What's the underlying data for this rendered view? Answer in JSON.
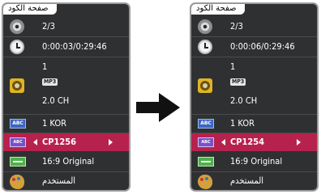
{
  "panels": [
    {
      "tab": "صفحة الكود",
      "title": "2/3",
      "time": "0:00:03/0:29:46",
      "audio_track": "1",
      "audio_codec": "MP3",
      "audio_channels": "2.0 CH",
      "subtitle": "1 KOR",
      "subtitle_code": "CP1256",
      "aspect": "16:9 Original",
      "picture_mode": "المستخدم"
    },
    {
      "tab": "صفحة الكود",
      "title": "2/3",
      "time": "0:00:06/0:29:46",
      "audio_track": "1",
      "audio_codec": "MP3",
      "audio_channels": "2.0 CH",
      "subtitle": "1 KOR",
      "subtitle_code": "CP1254",
      "aspect": "16:9 Original",
      "picture_mode": "المستخدم"
    }
  ],
  "icon_labels": {
    "subtitle": "ABC",
    "code_page": "ABC"
  },
  "icons": [
    "disc-icon",
    "clock-icon",
    "speaker-icon",
    "subtitle-icon",
    "code-page-icon",
    "aspect-icon",
    "palette-icon"
  ],
  "colors": {
    "panel_bg": "#2f3032",
    "highlight": "#b6224d",
    "border": "#9a9a9a"
  }
}
